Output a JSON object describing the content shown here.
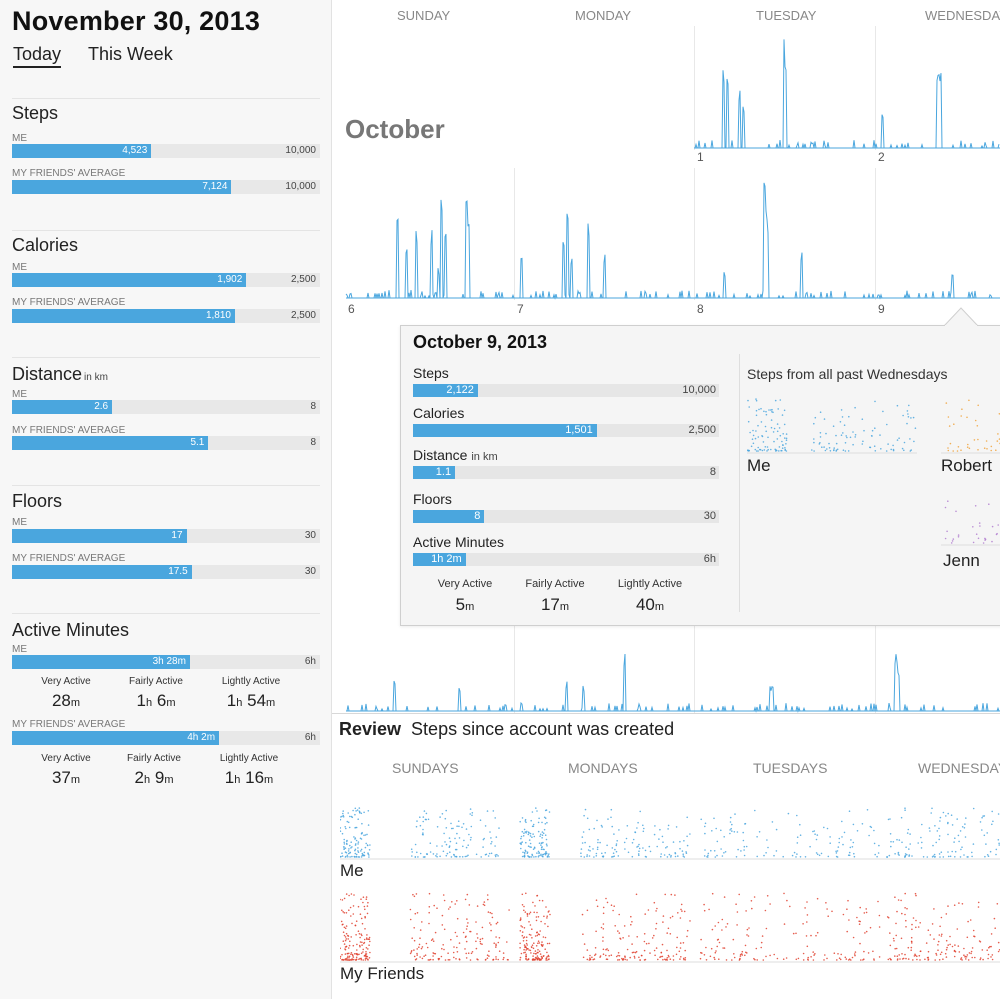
{
  "header": {
    "date": "November 30, 2013",
    "tabs": [
      "Today",
      "This Week"
    ]
  },
  "metrics": [
    {
      "title": "Steps",
      "unit": "",
      "rows": [
        {
          "label": "ME",
          "value": "4,523",
          "max": "10,000",
          "fraction": 0.4523
        },
        {
          "label": "MY FRIENDS' AVERAGE",
          "value": "7,124",
          "max": "10,000",
          "fraction": 0.7124
        }
      ]
    },
    {
      "title": "Calories",
      "unit": "",
      "rows": [
        {
          "label": "ME",
          "value": "1,902",
          "max": "2,500",
          "fraction": 0.7608
        },
        {
          "label": "MY FRIENDS' AVERAGE",
          "value": "1,810",
          "max": "2,500",
          "fraction": 0.724
        }
      ]
    },
    {
      "title": "Distance",
      "unit": "in km",
      "rows": [
        {
          "label": "ME",
          "value": "2.6",
          "max": "8",
          "fraction": 0.325
        },
        {
          "label": "MY FRIENDS' AVERAGE",
          "value": "5.1",
          "max": "8",
          "fraction": 0.6375
        }
      ]
    },
    {
      "title": "Floors",
      "unit": "",
      "rows": [
        {
          "label": "ME",
          "value": "17",
          "max": "30",
          "fraction": 0.5667
        },
        {
          "label": "MY FRIENDS' AVERAGE",
          "value": "17.5",
          "max": "30",
          "fraction": 0.5833
        }
      ]
    }
  ],
  "active_minutes": {
    "title": "Active Minutes",
    "rows": [
      {
        "label": "ME",
        "value": "3h 28m",
        "max": "6h",
        "fraction": 0.5778,
        "breakdown": [
          {
            "label": "Very Active",
            "a": "28",
            "au": "m",
            "b": "",
            "bu": ""
          },
          {
            "label": "Fairly Active",
            "a": "1",
            "au": "h",
            "b": "6",
            "bu": "m"
          },
          {
            "label": "Lightly Active",
            "a": "1",
            "au": "h",
            "b": "54",
            "bu": "m"
          }
        ]
      },
      {
        "label": "MY FRIENDS' AVERAGE",
        "value": "4h 2m",
        "max": "6h",
        "fraction": 0.6722,
        "breakdown": [
          {
            "label": "Very Active",
            "a": "37",
            "au": "m",
            "b": "",
            "bu": ""
          },
          {
            "label": "Fairly Active",
            "a": "2",
            "au": "h",
            "b": "9",
            "bu": "m"
          },
          {
            "label": "Lightly Active",
            "a": "1",
            "au": "h",
            "b": "16",
            "bu": "m"
          }
        ]
      }
    ]
  },
  "calendar": {
    "day_headers": [
      "SUNDAY",
      "MONDAY",
      "TUESDAY",
      "WEDNESDAY"
    ],
    "month": "October",
    "week1_dates": [
      "1",
      "2"
    ],
    "week2_dates": [
      "6",
      "7",
      "8",
      "9"
    ],
    "line_color": "#4aa6de"
  },
  "popup": {
    "title": "October 9, 2013",
    "metrics": [
      {
        "title": "Steps",
        "unit": "",
        "value": "2,122",
        "max": "10,000",
        "fraction": 0.2122
      },
      {
        "title": "Calories",
        "unit": "",
        "value": "1,501",
        "max": "2,500",
        "fraction": 0.6004
      },
      {
        "title": "Distance",
        "unit": "in km",
        "value": "1.1",
        "max": "8",
        "fraction": 0.1375
      },
      {
        "title": "Floors",
        "unit": "",
        "value": "8",
        "max": "30",
        "fraction": 0.2333
      },
      {
        "title": "Active Minutes",
        "unit": "",
        "value": "1h 2m",
        "max": "6h",
        "fraction": 0.1722
      }
    ],
    "breakdown": [
      {
        "label": "Very Active",
        "a": "5",
        "au": "m"
      },
      {
        "label": "Fairly Active",
        "a": "17",
        "au": "m"
      },
      {
        "label": "Lightly Active",
        "a": "40",
        "au": "m"
      }
    ],
    "subtitle": "Steps from all past Wednesdays",
    "people": [
      "Me",
      "Robert",
      "Jenn"
    ]
  },
  "review": {
    "title": "Review",
    "subtitle": "Steps since account was created",
    "day_headers": [
      "SUNDAYS",
      "MONDAYS",
      "TUESDAYS",
      "WEDNESDAYS"
    ],
    "people": [
      "Me",
      "My Friends"
    ],
    "colors": {
      "me": "#4aa6de",
      "friends": "#e0412f",
      "robert": "#f0a23a",
      "jenn": "#b07ccf"
    }
  }
}
